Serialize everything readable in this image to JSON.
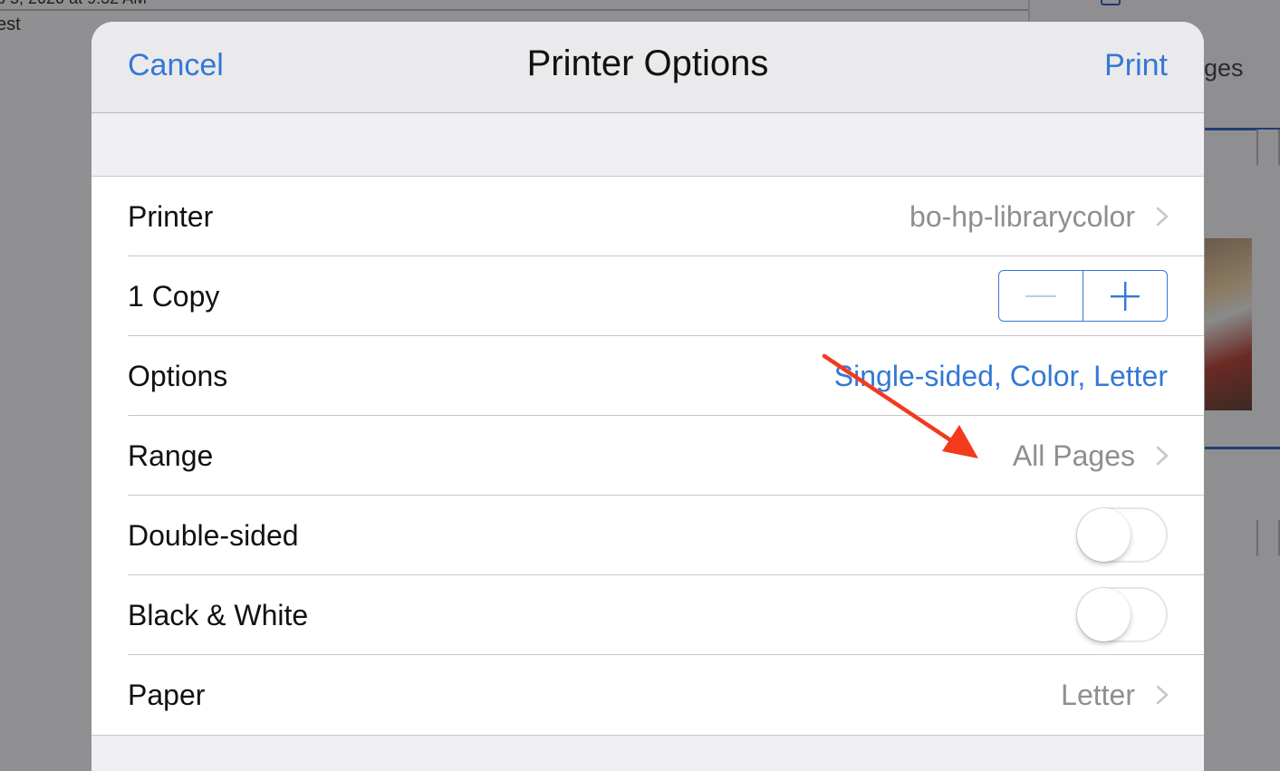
{
  "background": {
    "date_text": "b 5, 2020 at 9:32 AM",
    "email_text": "est",
    "side_label": "ges"
  },
  "nav": {
    "cancel_label": "Cancel",
    "title": "Printer Options",
    "print_label": "Print"
  },
  "rows": {
    "printer": {
      "label": "Printer",
      "value": "bo-hp-librarycolor",
      "icon": "chevron-right-icon"
    },
    "copies": {
      "label": "1 Copy",
      "count": 1,
      "decrement_icon": "minus-icon",
      "increment_icon": "plus-icon"
    },
    "options": {
      "label": "Options",
      "value": "Single-sided, Color, Letter"
    },
    "range": {
      "label": "Range",
      "value": "All Pages",
      "icon": "chevron-right-icon"
    },
    "double_sided": {
      "label": "Double-sided",
      "on": false
    },
    "black_white": {
      "label": "Black & White",
      "on": false
    },
    "paper": {
      "label": "Paper",
      "value": "Letter",
      "icon": "chevron-right-icon"
    }
  },
  "colors": {
    "accent": "#3478d6",
    "secondary_text": "#8e8e93",
    "annotation_arrow": "#f23a1d"
  }
}
